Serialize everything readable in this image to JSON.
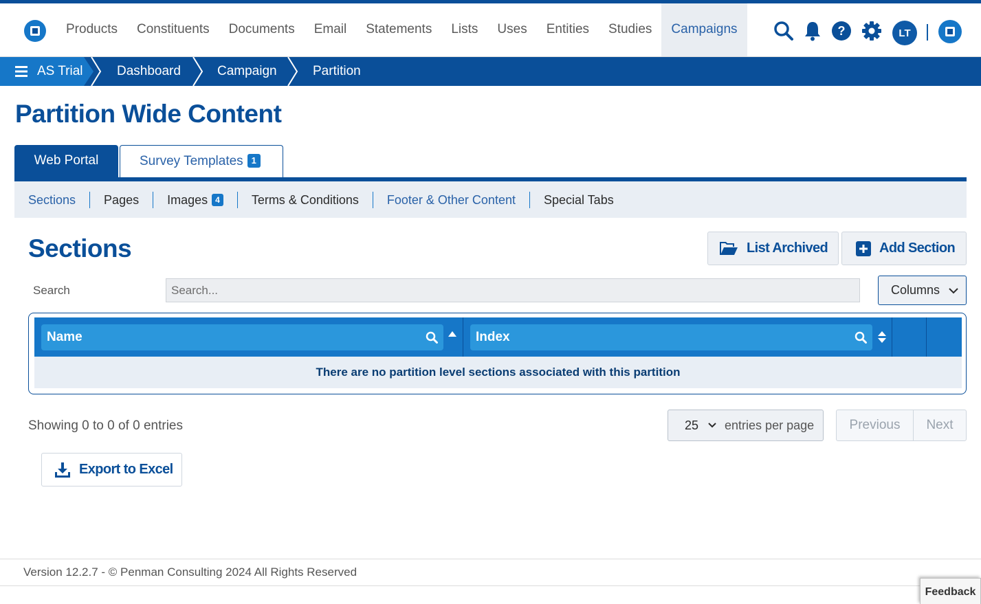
{
  "nav": {
    "items": [
      {
        "label": "Products"
      },
      {
        "label": "Constituents"
      },
      {
        "label": "Documents"
      },
      {
        "label": "Email"
      },
      {
        "label": "Statements"
      },
      {
        "label": "Lists"
      },
      {
        "label": "Uses"
      },
      {
        "label": "Entities"
      },
      {
        "label": "Studies"
      },
      {
        "label": "Campaigns",
        "active": true
      }
    ],
    "icons": [
      "search-icon",
      "bell-icon",
      "help-icon",
      "gear-icon"
    ],
    "avatar_initials": "LT"
  },
  "breadcrumb": {
    "items": [
      "AS Trial",
      "Dashboard",
      "Campaign",
      "Partition"
    ]
  },
  "page_title": "Partition Wide Content",
  "main_tabs": {
    "web_portal": "Web Portal",
    "survey_templates": "Survey Templates",
    "survey_templates_count": "1"
  },
  "sub_tabs": {
    "sections": "Sections",
    "pages": "Pages",
    "images": "Images",
    "images_count": "4",
    "terms": "Terms & Conditions",
    "footer": "Footer & Other Content",
    "special": "Special Tabs"
  },
  "sections": {
    "title": "Sections",
    "list_archived": "List Archived",
    "add_section": "Add Section",
    "search_label": "Search",
    "search_placeholder": "Search...",
    "columns_label": "Columns",
    "table": {
      "columns": [
        "Name",
        "Index"
      ],
      "empty_message": "There are no partition level sections associated with this partition"
    },
    "showing": "Showing 0 to 0 of 0 entries",
    "per_page_value": "25",
    "per_page_label": "entries per page",
    "prev": "Previous",
    "next": "Next",
    "export": "Export to Excel"
  },
  "footer": {
    "text": "Version 12.2.7 - © Penman Consulting 2024 All Rights Reserved"
  },
  "feedback": "Feedback",
  "colors": {
    "primary": "#0a4f99",
    "accent": "#1677c8",
    "header_cell": "#2b97dc"
  }
}
